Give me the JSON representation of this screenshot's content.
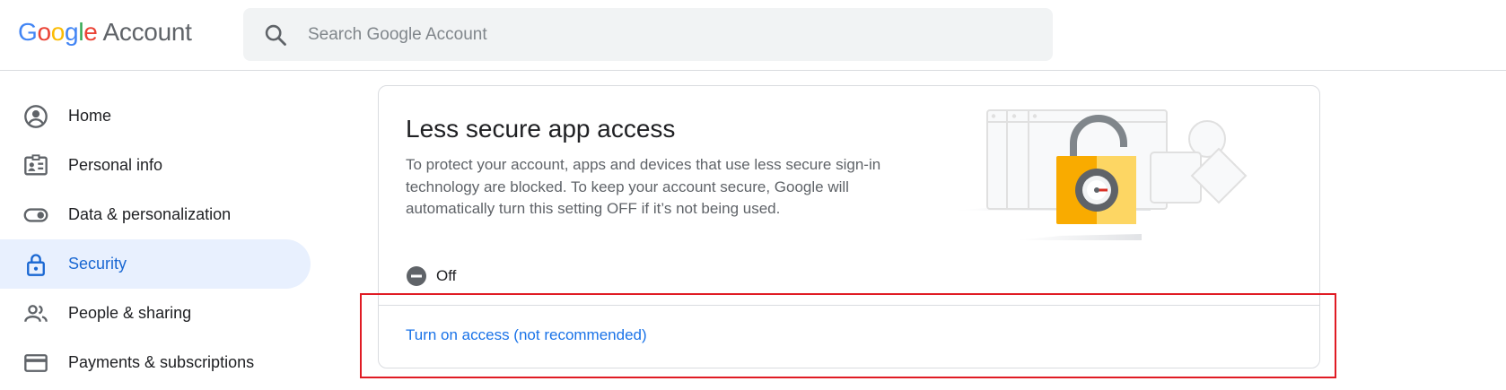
{
  "header": {
    "logo_letters": [
      {
        "char": "G",
        "color": "#4285F4"
      },
      {
        "char": "o",
        "color": "#EA4335"
      },
      {
        "char": "o",
        "color": "#FBBC05"
      },
      {
        "char": "g",
        "color": "#4285F4"
      },
      {
        "char": "l",
        "color": "#34A853"
      },
      {
        "char": "e",
        "color": "#EA4335"
      }
    ],
    "product": "Account",
    "search_placeholder": "Search Google Account"
  },
  "sidebar": {
    "items": [
      {
        "label": "Home",
        "icon": "account-circle-icon",
        "active": false
      },
      {
        "label": "Personal info",
        "icon": "id-card-icon",
        "active": false
      },
      {
        "label": "Data & personalization",
        "icon": "toggle-icon",
        "active": false
      },
      {
        "label": "Security",
        "icon": "lock-icon",
        "active": true
      },
      {
        "label": "People & sharing",
        "icon": "people-icon",
        "active": false
      },
      {
        "label": "Payments & subscriptions",
        "icon": "credit-card-icon",
        "active": false
      }
    ]
  },
  "card": {
    "title": "Less secure app access",
    "description": "To protect your account, apps and devices that use less secure sign-in technology are blocked. To keep your account secure, Google will automatically turn this setting OFF if it’s not being used.",
    "status_label": "Off",
    "status_icon": "minus-circle-icon",
    "action_label": "Turn on access (not recommended)",
    "illustration": "unlocked-padlock-illustration"
  },
  "colors": {
    "accent": "#1a73e8",
    "active_nav_bg": "#e8f0fe",
    "highlight_box": "#e01b24",
    "padlock": "#fbbc04"
  }
}
